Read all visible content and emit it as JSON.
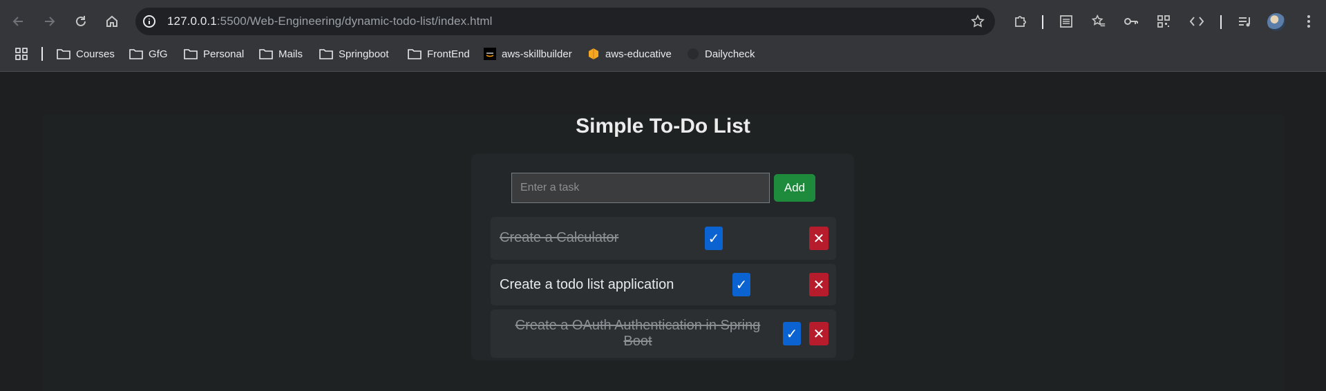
{
  "browser": {
    "url_host": "127.0.0.1",
    "url_rest": ":5500/Web-Engineering/dynamic-todo-list/index.html",
    "bookmarks": [
      {
        "label": "Courses",
        "icon": "folder-icon"
      },
      {
        "label": "GfG",
        "icon": "folder-icon"
      },
      {
        "label": "Personal",
        "icon": "folder-icon"
      },
      {
        "label": "Mails",
        "icon": "folder-icon"
      },
      {
        "label": "Springboot",
        "icon": "folder-icon"
      },
      {
        "label": "FrontEnd",
        "icon": "folder-icon"
      },
      {
        "label": "aws-skillbuilder",
        "icon": "aws-icon"
      },
      {
        "label": "aws-educative",
        "icon": "educative-icon"
      },
      {
        "label": "Dailycheck",
        "icon": "github-icon"
      }
    ]
  },
  "app": {
    "title": "Simple To-Do List",
    "input_placeholder": "Enter a task",
    "add_label": "Add",
    "check_glyph": "✓",
    "delete_glyph": "✕",
    "tasks": [
      {
        "text": "Create a Calculator",
        "completed": true
      },
      {
        "text": "Create a todo list application",
        "completed": false
      },
      {
        "text": "Create a OAuth Authentication in Spring Boot",
        "completed": true
      }
    ]
  },
  "colors": {
    "add_button": "#1e8a3c",
    "check_button": "#0b63d1",
    "delete_button": "#b71c2c"
  }
}
